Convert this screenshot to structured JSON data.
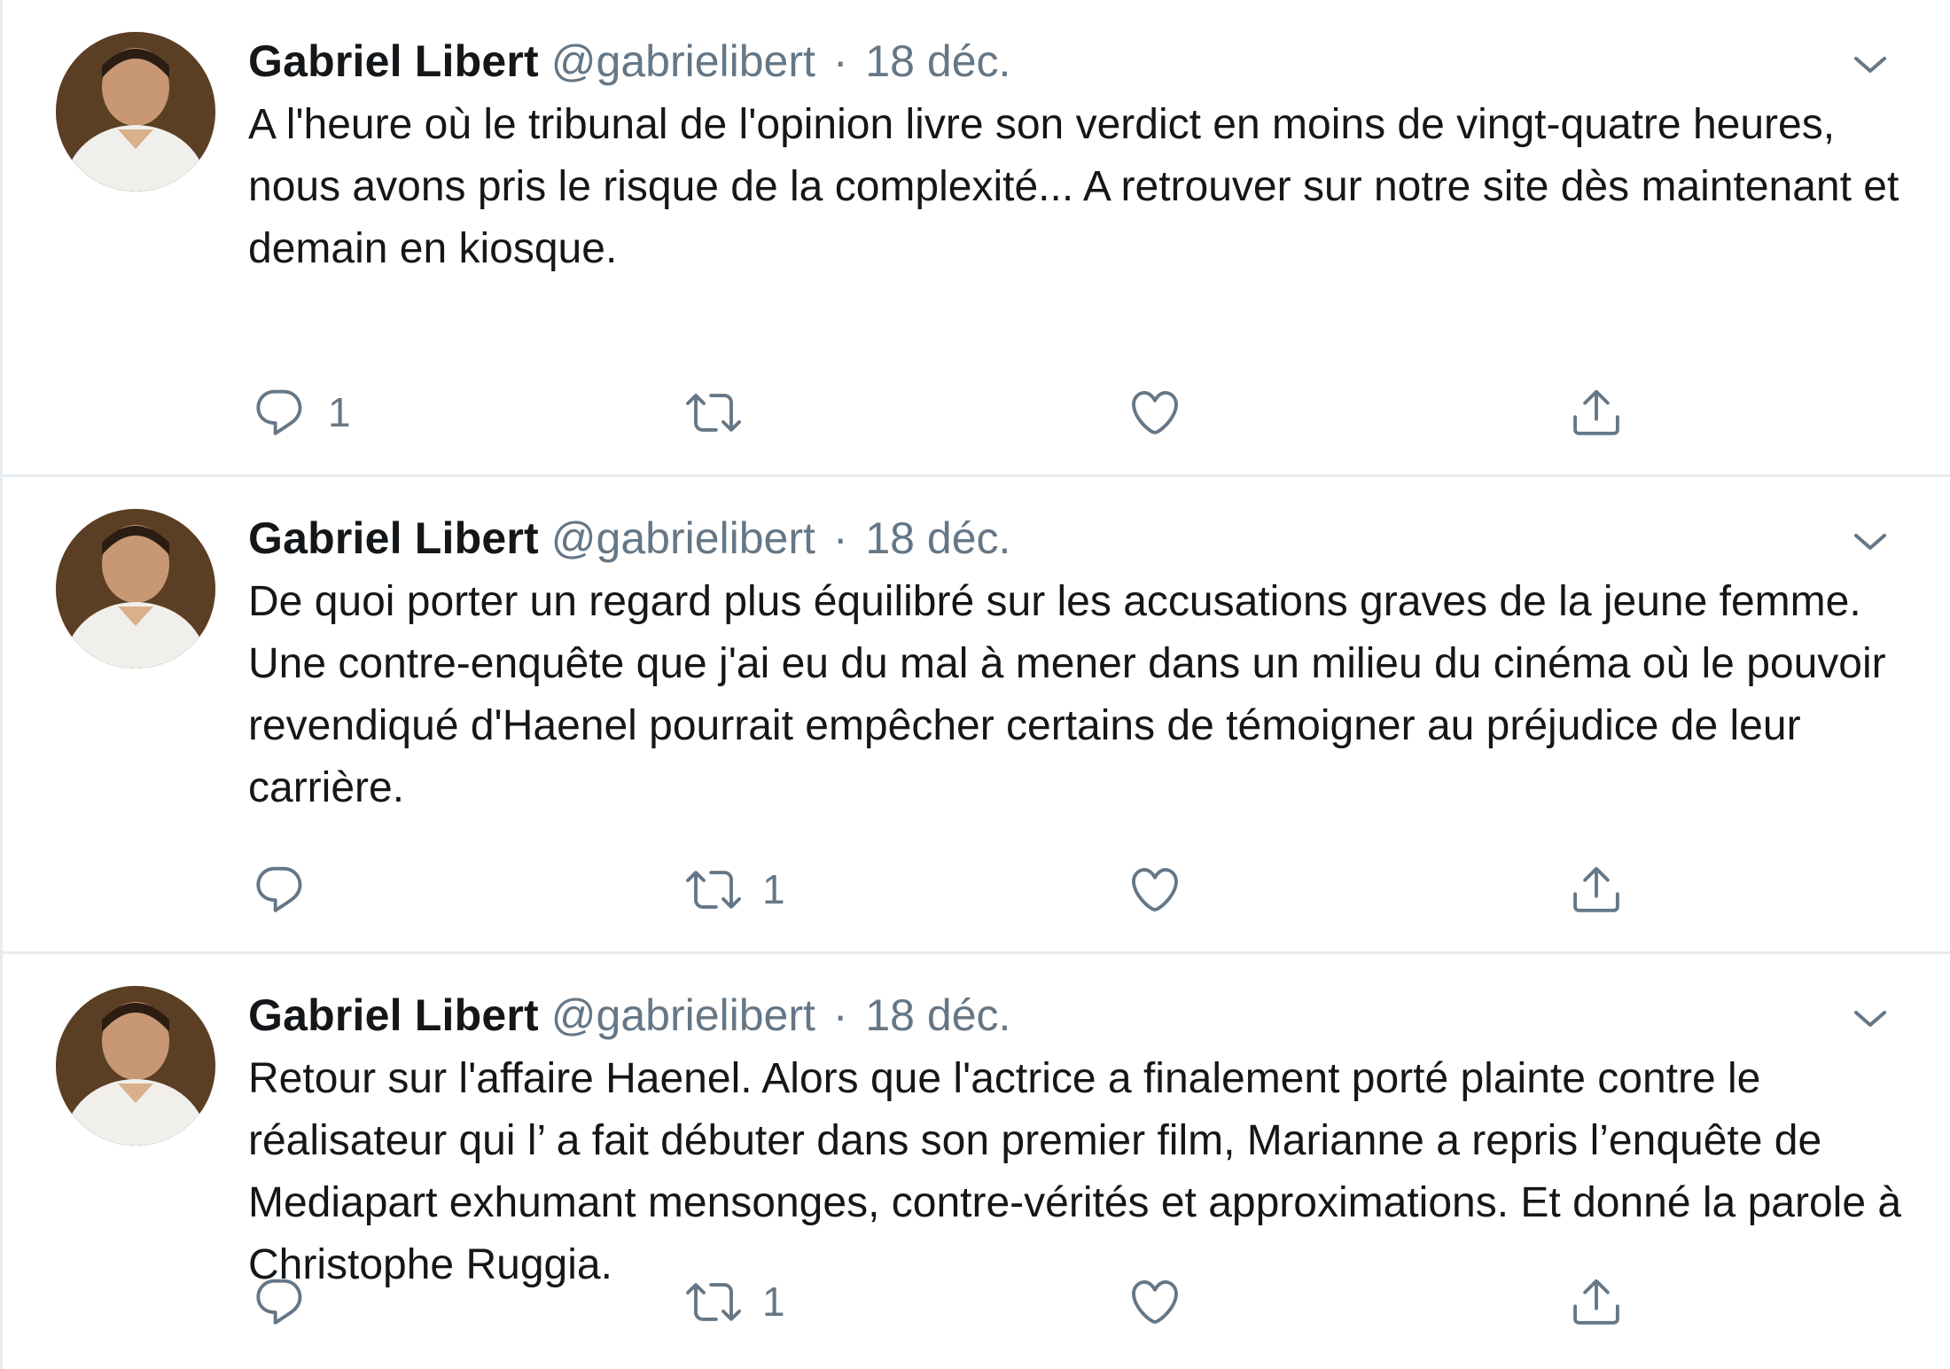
{
  "tweets": [
    {
      "author": {
        "name": "Gabriel Libert",
        "handle": "@gabrielibert",
        "avatar": "profile-photo"
      },
      "separator": "·",
      "date": "18 déc.",
      "text": "A l'heure où le tribunal de l'opinion livre son verdict en moins de vingt-quatre heures, nous avons pris le risque de la complexité... A retrouver sur notre site dès maintenant et demain en kiosque.",
      "actions": {
        "reply_count": "1",
        "retweet_count": "",
        "like_count": ""
      }
    },
    {
      "author": {
        "name": "Gabriel Libert",
        "handle": "@gabrielibert",
        "avatar": "profile-photo"
      },
      "separator": "·",
      "date": "18 déc.",
      "text": "De quoi porter un regard plus équilibré sur les accusations graves de la jeune femme. Une contre-enquête que j'ai eu du mal à mener dans un milieu du cinéma où le pouvoir revendiqué d'Haenel pourrait empêcher certains de témoigner au préjudice de leur carrière.",
      "actions": {
        "reply_count": "",
        "retweet_count": "1",
        "like_count": ""
      }
    },
    {
      "author": {
        "name": "Gabriel Libert",
        "handle": "@gabrielibert",
        "avatar": "profile-photo"
      },
      "separator": "·",
      "date": "18 déc.",
      "text": "Retour sur l'affaire Haenel. Alors que l'actrice a finalement porté plainte contre le réalisateur qui l’ a fait débuter dans son premier film, Marianne a repris l’enquête de Mediapart exhumant mensonges, contre-vérités et approximations. Et donné la parole à Christophe Ruggia.",
      "actions": {
        "reply_count": "",
        "retweet_count": "1",
        "like_count": ""
      }
    }
  ],
  "icons": {
    "reply": "reply-icon",
    "retweet": "retweet-icon",
    "like": "heart-icon",
    "share": "share-icon",
    "caret": "chevron-down-icon"
  },
  "colors": {
    "text": "#14171a",
    "secondary": "#657786",
    "divider": "#e6ecf0"
  }
}
